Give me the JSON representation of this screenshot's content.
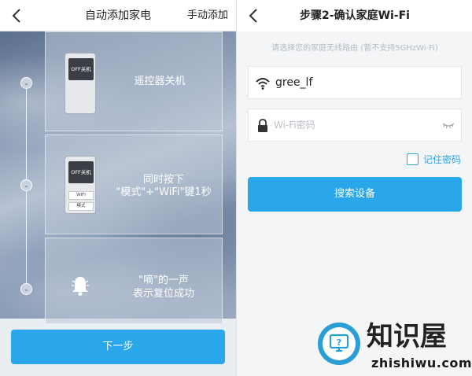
{
  "left": {
    "header": {
      "back_icon": "chevron-left-icon",
      "title": "自动添加家电",
      "action": "手动添加"
    },
    "steps": [
      {
        "text_line1": "遥控器关机",
        "remote_screen": "OFF关机"
      },
      {
        "text_line1": "同时按下",
        "text_line2": "\"模式\"+\"WiFi\"键1秒",
        "remote_screen": "OFF关机",
        "button_wifi": "WIFI",
        "button_mode": "模式"
      },
      {
        "text_line1": "\"嘀\"的一声",
        "text_line2": "表示复位成功",
        "icon": "bell-icon"
      }
    ],
    "next_button": "下一步"
  },
  "right": {
    "header": {
      "back_icon": "chevron-left-icon",
      "title": "步骤2-确认家庭Wi-Fi"
    },
    "hint": "请选择您的家庭无线路由 (暂不支持5GHzWi-Fi)",
    "ssid": {
      "icon": "wifi-icon",
      "value": "gree_lf"
    },
    "password": {
      "icon": "lock-icon",
      "placeholder": "Wi-Fi密码",
      "toggle_icon": "eye-closed-icon"
    },
    "remember_label": "记住密码",
    "remember_checked": false,
    "search_button": "搜索设备"
  },
  "watermark": {
    "brand": "知识屋",
    "domain": "zhishiwu.com"
  },
  "colors": {
    "accent": "#29a7ea",
    "hint": "#b6bcc4"
  }
}
